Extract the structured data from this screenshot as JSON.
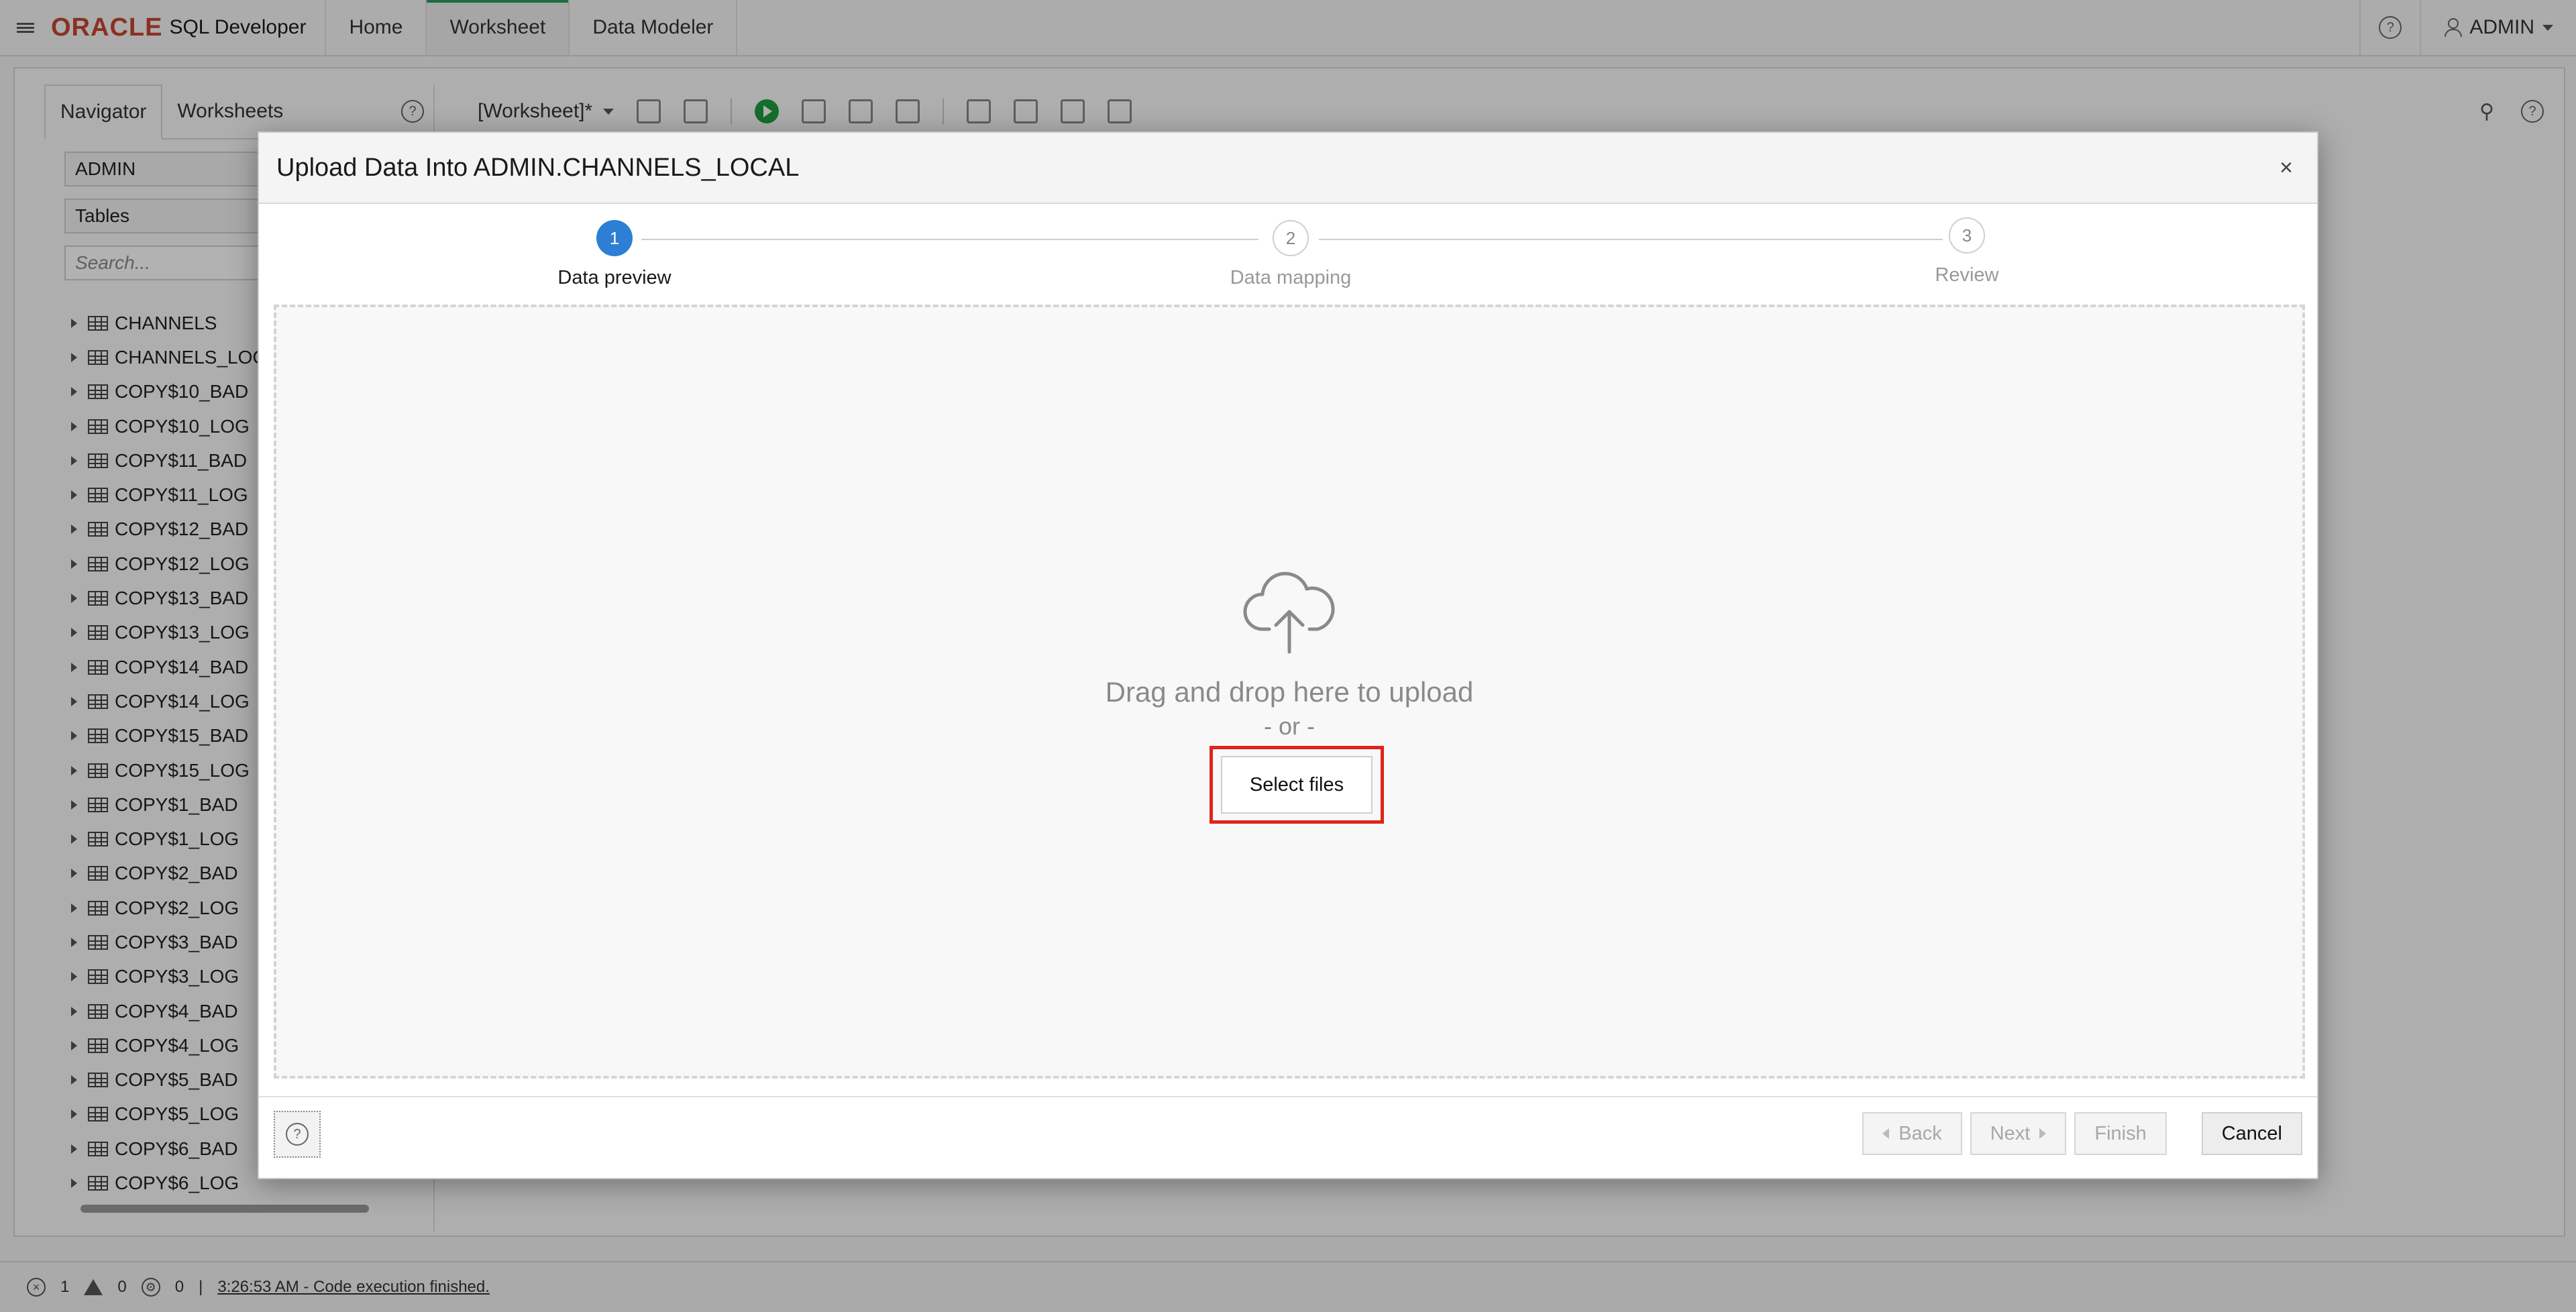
{
  "app": {
    "brand_oracle": "ORACLE",
    "brand_product": "SQL Developer",
    "tabs": [
      {
        "label": "Home"
      },
      {
        "label": "Worksheet"
      },
      {
        "label": "Data Modeler"
      }
    ],
    "help_glyph": "?",
    "user": "ADMIN"
  },
  "navigator": {
    "tabs": [
      {
        "label": "Navigator"
      },
      {
        "label": "Worksheets"
      }
    ],
    "schema": "ADMIN",
    "object_type": "Tables",
    "search_placeholder": "Search...",
    "items": [
      "CHANNELS",
      "CHANNELS_LOCA",
      "COPY$10_BAD",
      "COPY$10_LOG",
      "COPY$11_BAD",
      "COPY$11_LOG",
      "COPY$12_BAD",
      "COPY$12_LOG",
      "COPY$13_BAD",
      "COPY$13_LOG",
      "COPY$14_BAD",
      "COPY$14_LOG",
      "COPY$15_BAD",
      "COPY$15_LOG",
      "COPY$1_BAD",
      "COPY$1_LOG",
      "COPY$2_BAD",
      "COPY$2_LOG",
      "COPY$3_BAD",
      "COPY$3_LOG",
      "COPY$4_BAD",
      "COPY$4_LOG",
      "COPY$5_BAD",
      "COPY$5_LOG",
      "COPY$6_BAD",
      "COPY$6_LOG"
    ]
  },
  "worksheet": {
    "title": "[Worksheet]*"
  },
  "dialog": {
    "title": "Upload Data Into ADMIN.CHANNELS_LOCAL",
    "close_glyph": "×",
    "steps": [
      {
        "number": "1",
        "label": "Data preview",
        "state": "active"
      },
      {
        "number": "2",
        "label": "Data mapping",
        "state": "pending"
      },
      {
        "number": "3",
        "label": "Review",
        "state": "pending"
      }
    ],
    "drop_text": "Drag and drop here to upload",
    "or_text": "- or -",
    "select_files": "Select files",
    "buttons": {
      "back": "Back",
      "next": "Next",
      "finish": "Finish",
      "cancel": "Cancel"
    },
    "help_glyph": "?",
    "accent_color": "#2c7fd4",
    "highlight_color": "#e0231b"
  },
  "statusbar": {
    "errors": "1",
    "warnings": "0",
    "tasks": "0",
    "separator": "|",
    "message": "3:26:53 AM - Code execution finished."
  }
}
